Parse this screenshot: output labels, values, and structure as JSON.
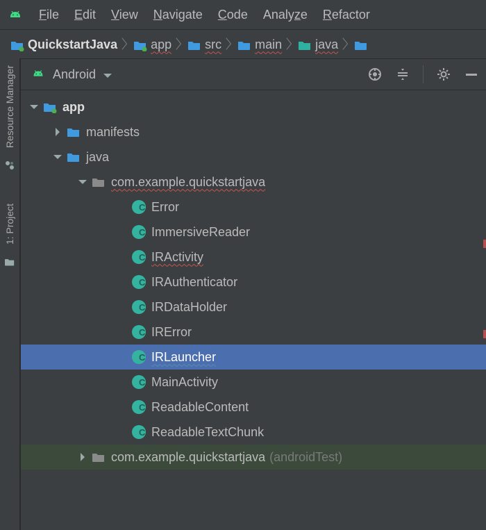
{
  "menu": {
    "items": [
      "File",
      "Edit",
      "View",
      "Navigate",
      "Code",
      "Analyze",
      "Refactor"
    ]
  },
  "breadcrumb": {
    "items": [
      {
        "label": "QuickstartJava",
        "icon": "module",
        "wavy": false
      },
      {
        "label": "app",
        "icon": "module",
        "wavy": true
      },
      {
        "label": "src",
        "icon": "folder-blue",
        "wavy": true
      },
      {
        "label": "main",
        "icon": "folder-blue",
        "wavy": true
      },
      {
        "label": "java",
        "icon": "folder-teal",
        "wavy": true
      }
    ]
  },
  "sideRail": {
    "resourceManager": "Resource Manager",
    "project": "1: Project"
  },
  "panel": {
    "viewMode": "Android"
  },
  "tree": {
    "app": "app",
    "manifests": "manifests",
    "java": "java",
    "pkg": "com.example.quickstartjava",
    "pkgTest": "com.example.quickstartjava",
    "pkgTestSuffix": "(androidTest)",
    "classes": [
      {
        "name": "Error",
        "wavy": false
      },
      {
        "name": "ImmersiveReader",
        "wavy": false
      },
      {
        "name": "IRActivity",
        "wavy": true
      },
      {
        "name": "IRAuthenticator",
        "wavy": false
      },
      {
        "name": "IRDataHolder",
        "wavy": false
      },
      {
        "name": "IRError",
        "wavy": false
      },
      {
        "name": "IRLauncher",
        "wavy": false,
        "selected": true,
        "wavyBlue": true
      },
      {
        "name": "MainActivity",
        "wavy": false
      },
      {
        "name": "ReadableContent",
        "wavy": false
      },
      {
        "name": "ReadableTextChunk",
        "wavy": false
      }
    ]
  }
}
